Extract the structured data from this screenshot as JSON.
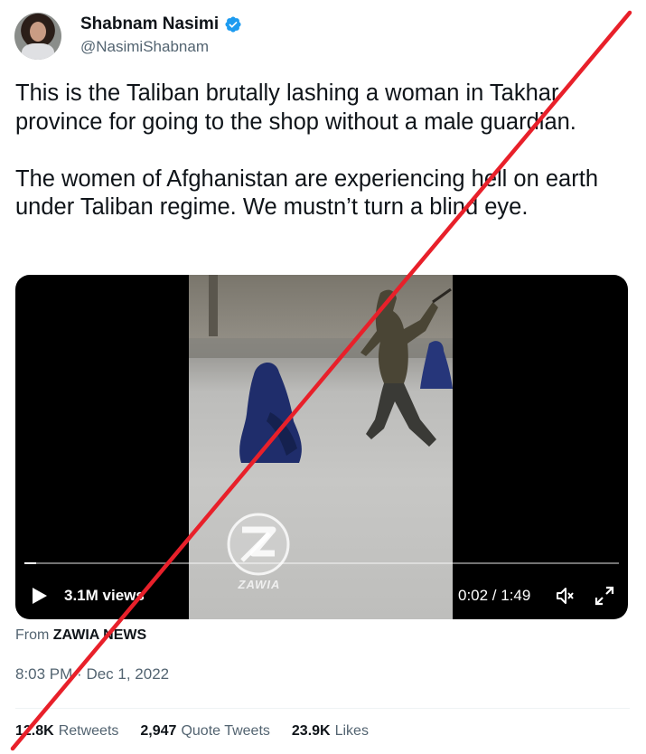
{
  "author": {
    "name": "Shabnam Nasimi",
    "handle": "@NasimiShabnam",
    "verified_icon": "verified-badge-icon"
  },
  "tweet": {
    "text": "This is the Taliban brutally lashing a woman in Takhar province for going to the shop without a male guardian.\n\nThe women of Afghanistan are experiencing hell on earth under Taliban regime. We mustn’t turn a blind eye."
  },
  "video": {
    "views": "3.1M views",
    "time": "0:02 / 1:49",
    "watermark_text": "ZAWIA",
    "progress": 0.02
  },
  "source": {
    "prefix": "From",
    "name": "ZAWIA NEWS"
  },
  "meta": {
    "time": "8:03 PM",
    "separator": "·",
    "date": "Dec 1, 2022"
  },
  "stats": {
    "retweets_count": "12.8K",
    "retweets_label": "Retweets",
    "quotes_count": "2,947",
    "quotes_label": "Quote Tweets",
    "likes_count": "23.9K",
    "likes_label": "Likes"
  },
  "overlay": {
    "cross_color": "#e8202a"
  },
  "colors": {
    "verified": "#1d9bf0",
    "secondary_text": "#536471"
  }
}
